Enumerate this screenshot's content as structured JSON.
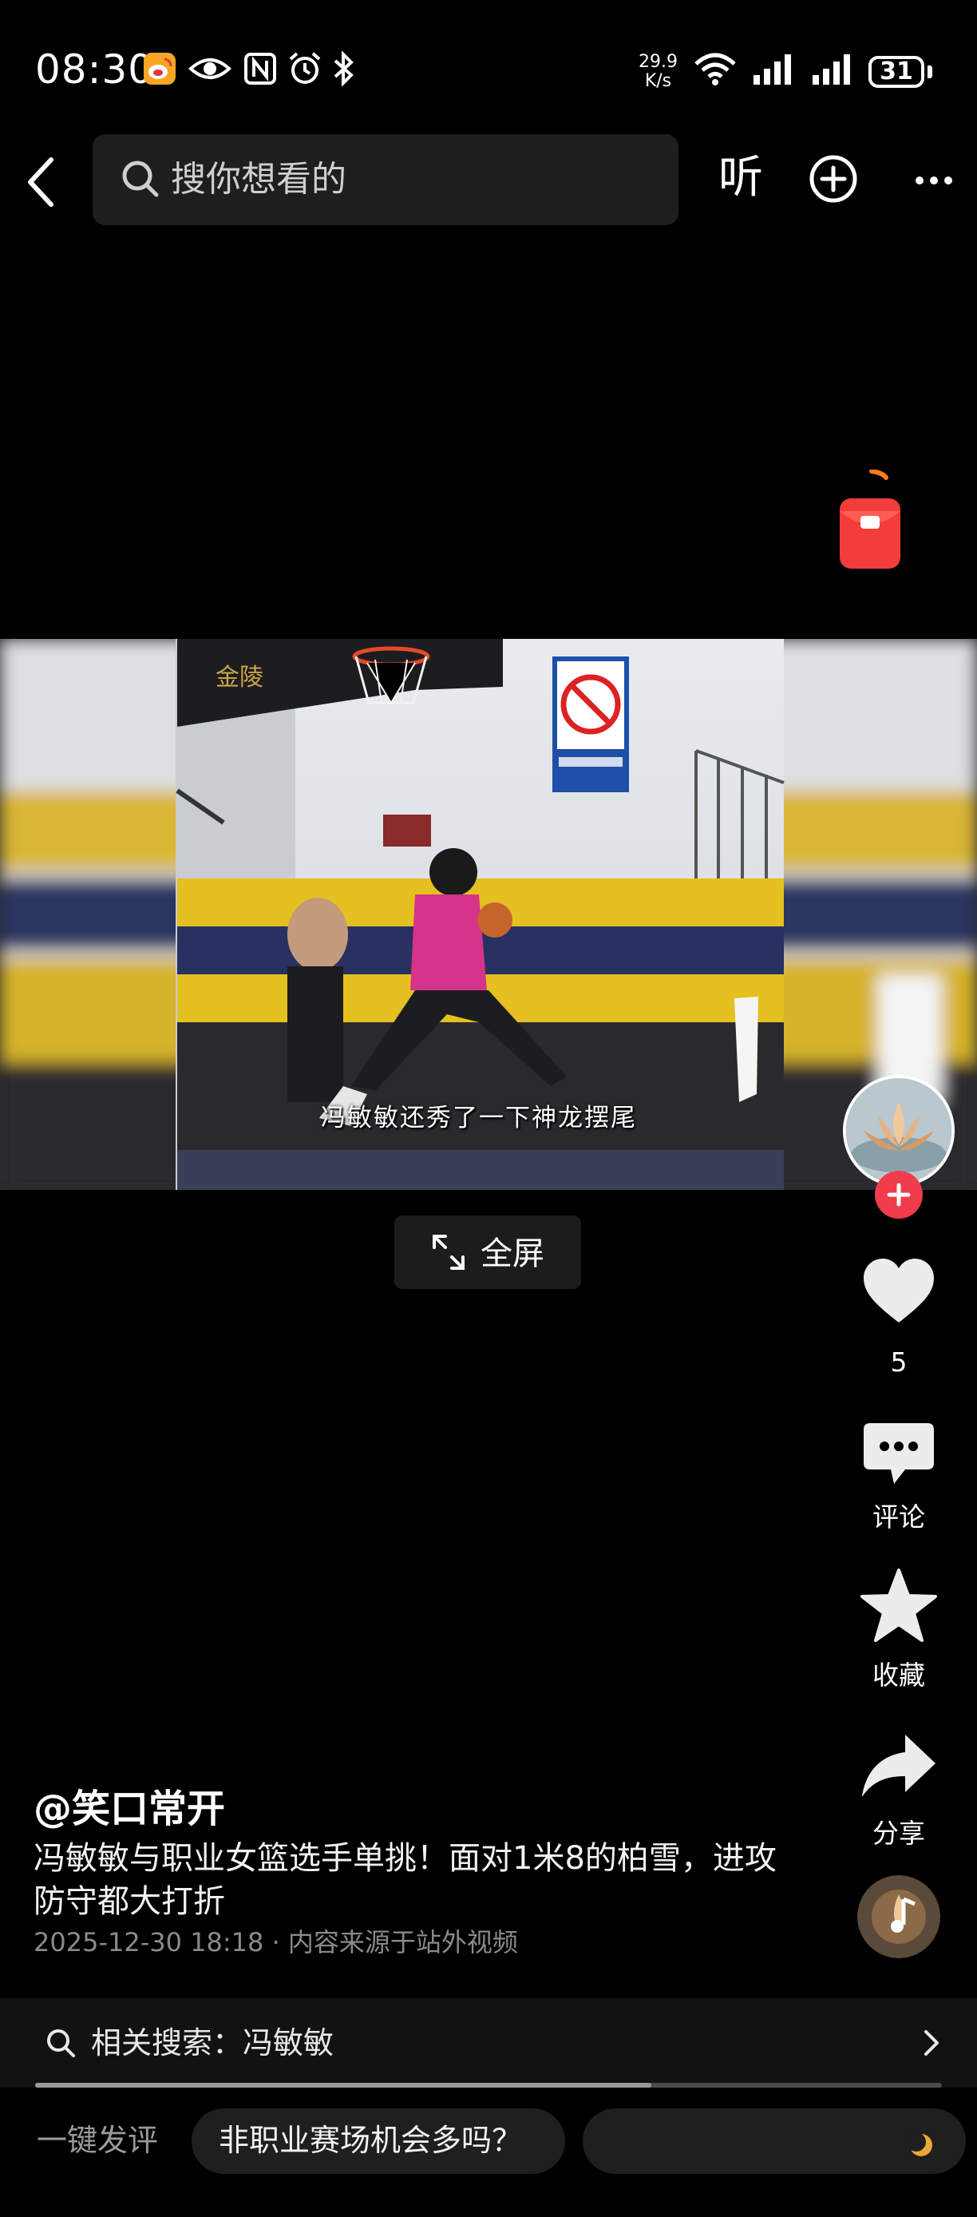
{
  "status_bar": {
    "time": "08:30",
    "net_speed_value": "29.9",
    "net_speed_unit": "K/s",
    "battery": "31",
    "icons": [
      "weibo-icon",
      "eye-icon",
      "nfc-icon",
      "alarm-icon",
      "bluetooth-icon",
      "wifi-icon",
      "signal-icon",
      "signal-icon"
    ]
  },
  "top_bar": {
    "search_placeholder": "搜你想看的",
    "listen_label": "听"
  },
  "video": {
    "subtitle": "冯敏敏还秀了一下神龙摆尾",
    "fullscreen_label": "全屏"
  },
  "side_rail": {
    "like_count": "5",
    "comment_label": "评论",
    "favorite_label": "收藏",
    "share_label": "分享"
  },
  "post": {
    "author": "@笑口常开",
    "description": "冯敏敏与职业女篮选手单挑！面对1米8的柏雪，进攻防守都大打折",
    "meta": "2025-12-30 18:18 · 内容来源于站外视频"
  },
  "related_search": {
    "label": "相关搜索：冯敏敏"
  },
  "playback": {
    "progress": 0.68
  },
  "bottom_bar": {
    "quick_comment_label": "一键发评",
    "suggestion_chip": "非职业赛场机会多吗？"
  },
  "colors": {
    "background": "#000000",
    "accent_red": "#f03c4c",
    "search_bg": "#1e1e1e"
  }
}
